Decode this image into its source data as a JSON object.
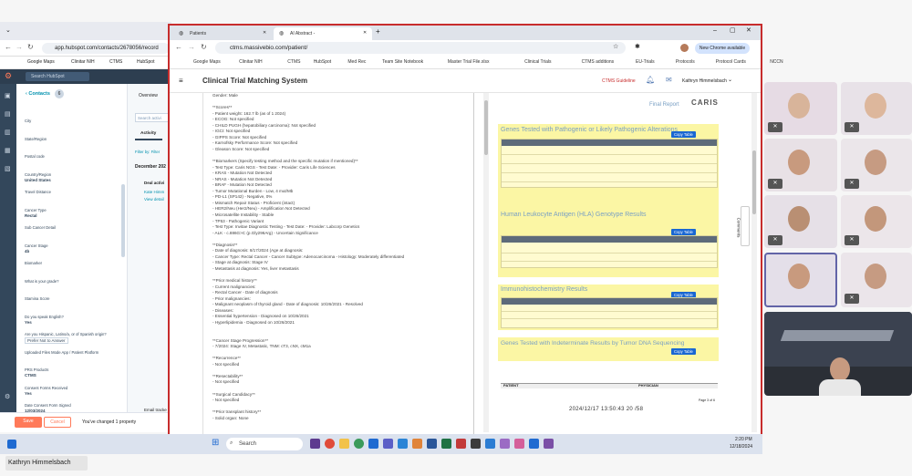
{
  "hubspot": {
    "url": "app.hubspot.com/contacts/2678056/record",
    "bookmarks": [
      "Google Maps",
      "Clinitar NIH",
      "CTMS",
      "HubSpot"
    ],
    "search_placeholder": "Search HubSpot",
    "contacts_label": "Contacts",
    "contacts_count": "6",
    "tab_overview": "Overview",
    "search_activity": "Search activi",
    "activity_tab": "Activity",
    "filter_by": "Filter by: Filter",
    "december": "December 202",
    "deal_activity": "Deal activi",
    "kate_link": "Kate Himm",
    "view_details": "View detail",
    "fields": [
      {
        "label": "City",
        "value": ""
      },
      {
        "label": "State/Region",
        "value": ""
      },
      {
        "label": "Postal code",
        "value": ""
      },
      {
        "label": "Country/Region",
        "value": "United States"
      },
      {
        "label": "Travel Distance",
        "value": ""
      },
      {
        "label": "Cancer Type",
        "value": "Rectal"
      },
      {
        "label": "Sub Cancer Detail",
        "value": ""
      },
      {
        "label": "Cancer Stage",
        "value": "4b"
      },
      {
        "label": "Biomarker",
        "value": ""
      },
      {
        "label": "What is your grade?",
        "value": ""
      },
      {
        "label": "Stamina Score",
        "value": ""
      },
      {
        "label": "Do you speak English?",
        "value": "Yes"
      },
      {
        "label": "Are you Hispanic, Latino/a, or of Spanish origin?",
        "value": "Prefer Not to Answer"
      },
      {
        "label": "Uploaded Files Mode App / Patient Platform",
        "value": ""
      },
      {
        "label": "PRS Products",
        "value": "CTMS"
      },
      {
        "label": "Consent Forms Received",
        "value": "Yes"
      },
      {
        "label": "Date Consent Form Signed",
        "value": "12/03/2024"
      }
    ],
    "save_label": "Save",
    "cancel_label": "Cancel",
    "changed_text": "You've changed 1 property",
    "email_tracker": "Email tracke"
  },
  "browser": {
    "tabs": [
      "Patients",
      "AI Abstract -"
    ],
    "url": "ctms.massivebio.com/patient/",
    "new_chrome": "New Chrome available",
    "bookmarks": [
      "Google Maps",
      "Clinitar NIH",
      "CTMS",
      "HubSpot",
      "Med Rec",
      "Team Site Notebook",
      "Master Trial File.xlsx",
      "Clinical Trials",
      "CTMS additions",
      "EU-Trials",
      "Protocols",
      "Protocol Cards",
      "NCCN"
    ]
  },
  "app": {
    "title": "Clinical Trial Matching System",
    "guideline_link": "CTMS Guideline",
    "user_name": "Kathryn Himmelsbach",
    "comments_label": "Comments"
  },
  "abstract_lines": [
    "Gender: Male",
    "",
    "**Scores**",
    "- Patient weight: 162.7 lb (as of 1      2024)",
    "- ECOG: Not specified",
    "- CHILD PUGH (hepatobiliary carcinoma): Not specified",
    "- IGCI: Not specified",
    "- GIPPS Score: Not specified",
    "- Karnofsky Performance Score: Not specified",
    "- Gleason Score: Not specified",
    "",
    "**Biomarkers (Specify testing method and the specific mutation if mentioned)**",
    "- Test Type: Caris NGS   - Test Date:              - Provider: Caris Life Sciences",
    "- KRAS - Mutation Not Detected",
    "- NRAS - Mutation Not Detected",
    "- BRAF - Mutation Not Detected",
    "- Tumor Mutational Burden - Low, 4 mut/Mb",
    "- PD-L1 (SP142) - Negative, 0%",
    "- Mismatch Repair Status - Proficient (intact)",
    "- HER2/Neu (Her2/Neu) - Amplification Not Detected",
    "- Microsatellite Instability - Stable",
    "- TP53 - Pathogenic Variant",
    "- Test Type: Invitae Diagnostic Testing  - Test Date:             - Provider: Labcorp Genetics",
    "- ALK - c.886G>C (p.Gly296Arg) - Uncertain Significance",
    "",
    "**Diagnosis**",
    "- Date of diagnosis: 8/17/2024 (Age at diagnosis:",
    "- Cancer Type: Rectal Cancer - Cancer Subtype: Adenocarcinoma - Histology: Moderately differentiated",
    "- Stage at diagnosis: Stage IV",
    "- Metastasis at diagnosis: Yes, liver metastasis",
    "",
    "**Prior medical history**",
    "- Current malignancies:",
    "  - Rectal Cancer - Date of diagnosis",
    "- Prior malignancies:",
    "  - Malignant neoplasm of thyroid gland - Date of diagnosis: 10/26/2021 - Resolved",
    "- Diseases:",
    "  - Essential hypertension - Diagnosed on 10/26/2021",
    "  - Hyperlipidemia - Diagnosed on 10/26/2021",
    "",
    "",
    "**Cancer Stage Progression**",
    "- 7/2024: Stage IV, Metastatic, TNM: cT3, cNX, cM1a",
    "",
    "**Recurrence**",
    "- Not specified",
    "",
    "**Resectability**",
    "- Not specified",
    "",
    "**Surgical Candidacy**",
    "- Not specified",
    "",
    "**Prior transplant history**",
    "- Solid organ: None"
  ],
  "report": {
    "final_report": "Final Report",
    "logo": "CARIS",
    "sections": [
      "Genes Tested with Pathogenic or Likely Pathogenic Alterations",
      "Human Leukocyte Antigen (HLA) Genotype Results",
      "Immunohistochemistry Results",
      "Genes Tested with Indeterminate Results by Tumor DNA Sequencing"
    ],
    "copy_table": "Copy Table",
    "footer_patient": "PATIENT",
    "footer_physician": "PHYSICIAN",
    "timestamp": "2024/12/17 13:50:43   20 /58",
    "page": "Page 3 of 6"
  },
  "taskbar": {
    "search": "Search",
    "time": "2:20 PM",
    "date": "12/18/2024"
  },
  "caller_name": "Kathryn Himmelsbach",
  "colors": {
    "hubspot_orange": "#ff7a59",
    "browser_frame": "#c72c2c",
    "highlight": "#fbf6a4",
    "chrome_blue": "#1967d2"
  }
}
